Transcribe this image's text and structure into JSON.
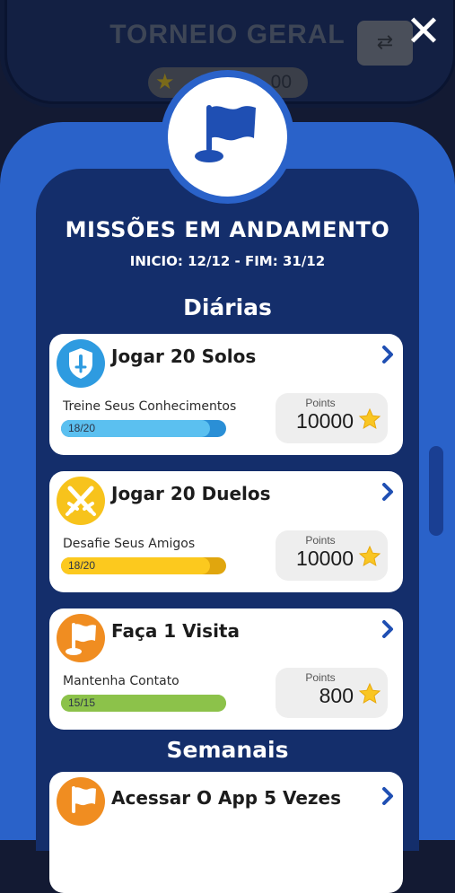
{
  "background": {
    "title": "TORNEIO GERAL",
    "score": "00",
    "swap_icon": "swap-arrows-icon"
  },
  "close_icon": "close-icon",
  "modal": {
    "title": "MISSÕES EM ANDAMENTO",
    "dates": "INICIO: 12/12 - FIM: 31/12",
    "flag_icon": "flag-icon"
  },
  "sections": {
    "daily": "Diárias",
    "weekly": "Semanais"
  },
  "missions": [
    {
      "title": "Jogar 20 Solos",
      "subtitle": "Treine Seus Conhecimentos",
      "progress_text": "18/20",
      "progress": 0.9,
      "reward_label": "Points",
      "reward_value": "10000",
      "icon": "shield-icon",
      "color": "#2e9be0",
      "bar_fill": "#5bc0f0",
      "bar_track": "#2a8fd6"
    },
    {
      "title": "Jogar 20 Duelos",
      "subtitle": "Desafie Seus Amigos",
      "progress_text": "18/20",
      "progress": 0.9,
      "reward_label": "Points",
      "reward_value": "10000",
      "icon": "crossed-swords-icon",
      "color": "#f7c31c",
      "bar_fill": "#fcc91e",
      "bar_track": "#e0a60e"
    },
    {
      "title": "Faça 1 Visita",
      "subtitle": "Mantenha Contato",
      "progress_text": "15/15",
      "progress": 1.0,
      "reward_label": "Points",
      "reward_value": "800",
      "icon": "flag-icon",
      "color": "#f08d21",
      "bar_fill": "#8cc24a",
      "bar_track": "#8cc24a"
    }
  ],
  "weekly_missions": [
    {
      "title": "Acessar O App 5 Vezes",
      "icon": "flag-icon",
      "color": "#f08d21"
    }
  ],
  "colors": {
    "modal_border": "#2a62c9",
    "modal_body": "#142e6b",
    "chevron": "#1f4fb3",
    "star": "#f9c623"
  }
}
